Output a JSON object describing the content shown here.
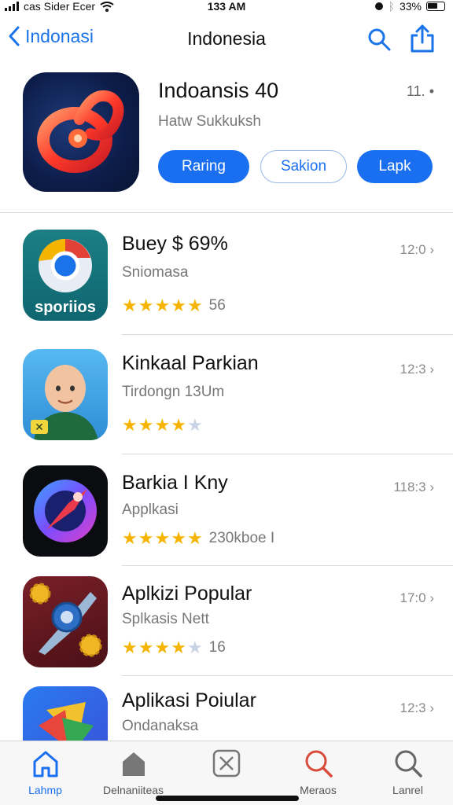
{
  "status_bar": {
    "carrier": "cas Sider Ecer",
    "time": "133 AM",
    "battery": "33%"
  },
  "nav": {
    "back_label": "Indonasi",
    "title": "Indonesia"
  },
  "hero": {
    "name": "Indoansis 40",
    "more": "11. •",
    "subtitle": "Hatw Sukkuksh",
    "buttons": [
      "Raring",
      "Sakion",
      "Lapk"
    ]
  },
  "apps": [
    {
      "title": "Buey $ 69%",
      "subtitle": "Sniomasa",
      "icon_label": "sporiios",
      "rating": 5,
      "rating_text": "56",
      "time": "12:0"
    },
    {
      "title": "Kinkaal Parkian",
      "subtitle": "Tirdongn 13Um",
      "icon_label": "",
      "rating": 4,
      "rating_text": "",
      "time": "12:3"
    },
    {
      "title": "Barkia I Kny",
      "subtitle": "Applkasi",
      "icon_label": "",
      "rating": 5,
      "rating_text": "230kboe I",
      "time": "118:3"
    },
    {
      "title": "Aplkizi Popular",
      "subtitle": "Splkasis Nett",
      "icon_label": "",
      "rating": 4,
      "rating_text": "16",
      "time": "17:0"
    },
    {
      "title": "Aplikasi Poiular",
      "subtitle": "Ondanaksa",
      "icon_label": "",
      "rating": null,
      "rating_text": "",
      "time": "12:3"
    }
  ],
  "tabs": [
    {
      "label": "Lahmp",
      "icon": "home-icon",
      "active": true
    },
    {
      "label": "Delnaniiteas",
      "icon": "home-filled-icon",
      "active": false
    },
    {
      "label": "",
      "icon": "apps-icon",
      "active": false
    },
    {
      "label": "Meraos",
      "icon": "search-icon",
      "active": false
    },
    {
      "label": "Lanrel",
      "icon": "search-icon",
      "active": false
    }
  ],
  "colors": {
    "accent": "#1a6ff0",
    "star": "#f5b400",
    "star_empty": "#c9d3e6",
    "search_red": "#d94b3b"
  }
}
